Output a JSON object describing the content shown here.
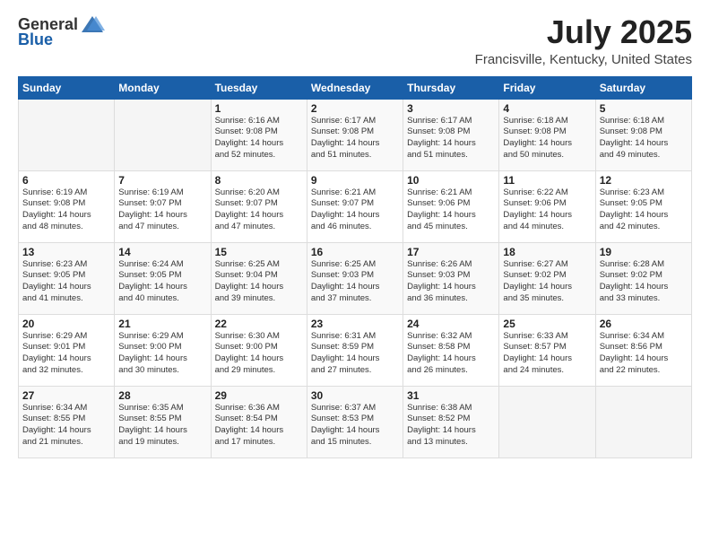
{
  "header": {
    "logo_general": "General",
    "logo_blue": "Blue",
    "month_year": "July 2025",
    "location": "Francisville, Kentucky, United States"
  },
  "weekdays": [
    "Sunday",
    "Monday",
    "Tuesday",
    "Wednesday",
    "Thursday",
    "Friday",
    "Saturday"
  ],
  "weeks": [
    [
      {
        "day": "",
        "info": ""
      },
      {
        "day": "",
        "info": ""
      },
      {
        "day": "1",
        "info": "Sunrise: 6:16 AM\nSunset: 9:08 PM\nDaylight: 14 hours\nand 52 minutes."
      },
      {
        "day": "2",
        "info": "Sunrise: 6:17 AM\nSunset: 9:08 PM\nDaylight: 14 hours\nand 51 minutes."
      },
      {
        "day": "3",
        "info": "Sunrise: 6:17 AM\nSunset: 9:08 PM\nDaylight: 14 hours\nand 51 minutes."
      },
      {
        "day": "4",
        "info": "Sunrise: 6:18 AM\nSunset: 9:08 PM\nDaylight: 14 hours\nand 50 minutes."
      },
      {
        "day": "5",
        "info": "Sunrise: 6:18 AM\nSunset: 9:08 PM\nDaylight: 14 hours\nand 49 minutes."
      }
    ],
    [
      {
        "day": "6",
        "info": "Sunrise: 6:19 AM\nSunset: 9:08 PM\nDaylight: 14 hours\nand 48 minutes."
      },
      {
        "day": "7",
        "info": "Sunrise: 6:19 AM\nSunset: 9:07 PM\nDaylight: 14 hours\nand 47 minutes."
      },
      {
        "day": "8",
        "info": "Sunrise: 6:20 AM\nSunset: 9:07 PM\nDaylight: 14 hours\nand 47 minutes."
      },
      {
        "day": "9",
        "info": "Sunrise: 6:21 AM\nSunset: 9:07 PM\nDaylight: 14 hours\nand 46 minutes."
      },
      {
        "day": "10",
        "info": "Sunrise: 6:21 AM\nSunset: 9:06 PM\nDaylight: 14 hours\nand 45 minutes."
      },
      {
        "day": "11",
        "info": "Sunrise: 6:22 AM\nSunset: 9:06 PM\nDaylight: 14 hours\nand 44 minutes."
      },
      {
        "day": "12",
        "info": "Sunrise: 6:23 AM\nSunset: 9:05 PM\nDaylight: 14 hours\nand 42 minutes."
      }
    ],
    [
      {
        "day": "13",
        "info": "Sunrise: 6:23 AM\nSunset: 9:05 PM\nDaylight: 14 hours\nand 41 minutes."
      },
      {
        "day": "14",
        "info": "Sunrise: 6:24 AM\nSunset: 9:05 PM\nDaylight: 14 hours\nand 40 minutes."
      },
      {
        "day": "15",
        "info": "Sunrise: 6:25 AM\nSunset: 9:04 PM\nDaylight: 14 hours\nand 39 minutes."
      },
      {
        "day": "16",
        "info": "Sunrise: 6:25 AM\nSunset: 9:03 PM\nDaylight: 14 hours\nand 37 minutes."
      },
      {
        "day": "17",
        "info": "Sunrise: 6:26 AM\nSunset: 9:03 PM\nDaylight: 14 hours\nand 36 minutes."
      },
      {
        "day": "18",
        "info": "Sunrise: 6:27 AM\nSunset: 9:02 PM\nDaylight: 14 hours\nand 35 minutes."
      },
      {
        "day": "19",
        "info": "Sunrise: 6:28 AM\nSunset: 9:02 PM\nDaylight: 14 hours\nand 33 minutes."
      }
    ],
    [
      {
        "day": "20",
        "info": "Sunrise: 6:29 AM\nSunset: 9:01 PM\nDaylight: 14 hours\nand 32 minutes."
      },
      {
        "day": "21",
        "info": "Sunrise: 6:29 AM\nSunset: 9:00 PM\nDaylight: 14 hours\nand 30 minutes."
      },
      {
        "day": "22",
        "info": "Sunrise: 6:30 AM\nSunset: 9:00 PM\nDaylight: 14 hours\nand 29 minutes."
      },
      {
        "day": "23",
        "info": "Sunrise: 6:31 AM\nSunset: 8:59 PM\nDaylight: 14 hours\nand 27 minutes."
      },
      {
        "day": "24",
        "info": "Sunrise: 6:32 AM\nSunset: 8:58 PM\nDaylight: 14 hours\nand 26 minutes."
      },
      {
        "day": "25",
        "info": "Sunrise: 6:33 AM\nSunset: 8:57 PM\nDaylight: 14 hours\nand 24 minutes."
      },
      {
        "day": "26",
        "info": "Sunrise: 6:34 AM\nSunset: 8:56 PM\nDaylight: 14 hours\nand 22 minutes."
      }
    ],
    [
      {
        "day": "27",
        "info": "Sunrise: 6:34 AM\nSunset: 8:55 PM\nDaylight: 14 hours\nand 21 minutes."
      },
      {
        "day": "28",
        "info": "Sunrise: 6:35 AM\nSunset: 8:55 PM\nDaylight: 14 hours\nand 19 minutes."
      },
      {
        "day": "29",
        "info": "Sunrise: 6:36 AM\nSunset: 8:54 PM\nDaylight: 14 hours\nand 17 minutes."
      },
      {
        "day": "30",
        "info": "Sunrise: 6:37 AM\nSunset: 8:53 PM\nDaylight: 14 hours\nand 15 minutes."
      },
      {
        "day": "31",
        "info": "Sunrise: 6:38 AM\nSunset: 8:52 PM\nDaylight: 14 hours\nand 13 minutes."
      },
      {
        "day": "",
        "info": ""
      },
      {
        "day": "",
        "info": ""
      }
    ]
  ]
}
